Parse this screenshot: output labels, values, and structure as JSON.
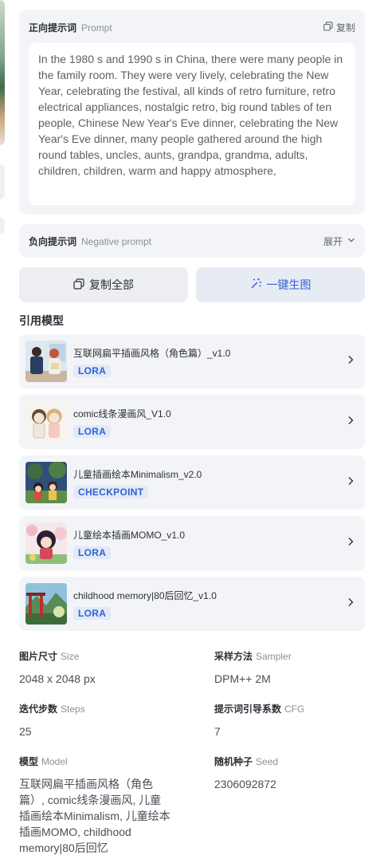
{
  "prompt": {
    "title": "正向提示词",
    "title_en": "Prompt",
    "copy_label": "复制",
    "text": "In the 1980 s and 1990 s in China, there were many people in the family room. They were very lively, celebrating the New Year, celebrating the festival, all kinds of retro furniture, retro electrical appliances, nostalgic retro, big round tables of ten people, Chinese New Year's Eve dinner, celebrating the New Year's Eve dinner, many people gathered around the high round tables, uncles, aunts, grandpa, grandma, adults, children, children, warm and happy atmosphere,"
  },
  "negative": {
    "title": "负向提示词",
    "title_en": "Negative prompt",
    "expand_label": "展开"
  },
  "actions": {
    "copy_all": "复制全部",
    "generate": "一键生图"
  },
  "models_title": "引用模型",
  "models": [
    {
      "name": "互联网扁平插画风格（角色篇）_v1.0",
      "type": "LORA"
    },
    {
      "name": "comic线条漫画风_V1.0",
      "type": "LORA"
    },
    {
      "name": "儿童插画绘本Minimalism_v2.0",
      "type": "CHECKPOINT"
    },
    {
      "name": "儿童绘本插画MOMO_v1.0",
      "type": "LORA"
    },
    {
      "name": "childhood memory|80后回忆_v1.0",
      "type": "LORA"
    }
  ],
  "params": {
    "size": {
      "label": "图片尺寸",
      "label_en": "Size",
      "value": "2048 x 2048 px"
    },
    "sampler": {
      "label": "采样方法",
      "label_en": "Sampler",
      "value": "DPM++ 2M"
    },
    "steps": {
      "label": "迭代步数",
      "label_en": "Steps",
      "value": "25"
    },
    "cfg": {
      "label": "提示词引导系数",
      "label_en": "CFG",
      "value": "7"
    },
    "model": {
      "label": "模型",
      "label_en": "Model",
      "value": "互联网扁平插画风格（角色篇）, comic线条漫画风, 儿童插画绘本Minimalism, 儿童绘本插画MOMO, childhood memory|80后回忆"
    },
    "seed": {
      "label": "随机种子",
      "label_en": "Seed",
      "value": "2306092872"
    }
  },
  "colors": {
    "accent": "#2f63d4",
    "card_bg": "#f3f4f7"
  }
}
